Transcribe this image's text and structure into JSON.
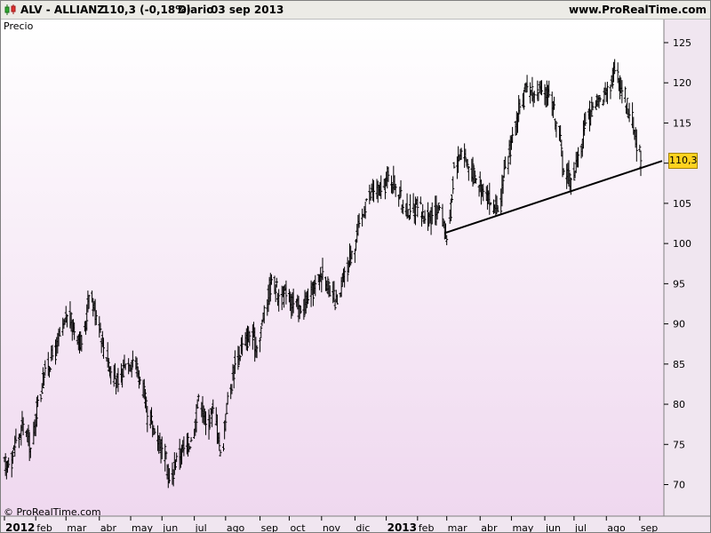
{
  "header": {
    "ticker": "ALV - ALLIANZ",
    "change": "110,3 (-0,18%)",
    "period": "Diario",
    "date": "03 sep 2013",
    "site": "www.ProRealTime.com"
  },
  "plot_label": "Precio",
  "copyright": "© ProRealTime.com",
  "last_price_label": "110,3",
  "colors": {
    "background": "#f0e6f0",
    "bars": "#000000",
    "price_box": "#ffd21f",
    "trendline": "#000000"
  },
  "chart_data": {
    "type": "ohlc",
    "title": "ALV - ALLIANZ",
    "xlabel": "",
    "ylabel": "",
    "ylim": [
      66,
      127
    ],
    "yticks": [
      70,
      75,
      80,
      85,
      90,
      95,
      100,
      105,
      110,
      115,
      120,
      125
    ],
    "x_range": [
      "2012-01-02",
      "2013-09-03"
    ],
    "xticks": [
      {
        "label": "2012",
        "date": "2012-01-02",
        "bold": true
      },
      {
        "label": "feb",
        "date": "2012-02-01",
        "bold": false
      },
      {
        "label": "mar",
        "date": "2012-03-01",
        "bold": false
      },
      {
        "label": "abr",
        "date": "2012-04-02",
        "bold": false
      },
      {
        "label": "may",
        "date": "2012-05-02",
        "bold": false
      },
      {
        "label": "jun",
        "date": "2012-06-01",
        "bold": false
      },
      {
        "label": "jul",
        "date": "2012-07-02",
        "bold": false
      },
      {
        "label": "ago",
        "date": "2012-08-01",
        "bold": false
      },
      {
        "label": "sep",
        "date": "2012-09-03",
        "bold": false
      },
      {
        "label": "oct",
        "date": "2012-10-01",
        "bold": false
      },
      {
        "label": "nov",
        "date": "2012-11-01",
        "bold": false
      },
      {
        "label": "dic",
        "date": "2012-12-03",
        "bold": false
      },
      {
        "label": "2013",
        "date": "2013-01-02",
        "bold": true
      },
      {
        "label": "feb",
        "date": "2013-02-01",
        "bold": false
      },
      {
        "label": "mar",
        "date": "2013-03-01",
        "bold": false
      },
      {
        "label": "abr",
        "date": "2013-04-02",
        "bold": false
      },
      {
        "label": "may",
        "date": "2013-05-02",
        "bold": false
      },
      {
        "label": "jun",
        "date": "2013-06-03",
        "bold": false
      },
      {
        "label": "jul",
        "date": "2013-07-01",
        "bold": false
      },
      {
        "label": "ago",
        "date": "2013-08-01",
        "bold": false
      },
      {
        "label": "sep",
        "date": "2013-09-02",
        "bold": false
      }
    ],
    "last_price": 110.3,
    "series": [
      {
        "weekly_close": [
          [
            "2012-01-02",
            72.5
          ],
          [
            "2012-01-09",
            75.5
          ],
          [
            "2012-01-16",
            77.5
          ],
          [
            "2012-01-23",
            74.5
          ],
          [
            "2012-01-30",
            80.5
          ],
          [
            "2012-02-06",
            84.5
          ],
          [
            "2012-02-13",
            86.0
          ],
          [
            "2012-02-20",
            88.5
          ],
          [
            "2012-02-27",
            91.0
          ],
          [
            "2012-03-05",
            89.0
          ],
          [
            "2012-03-12",
            87.5
          ],
          [
            "2012-03-19",
            93.5
          ],
          [
            "2012-03-26",
            91.0
          ],
          [
            "2012-04-02",
            87.0
          ],
          [
            "2012-04-09",
            84.0
          ],
          [
            "2012-04-16",
            82.5
          ],
          [
            "2012-04-23",
            85.0
          ],
          [
            "2012-04-30",
            85.5
          ],
          [
            "2012-05-07",
            83.0
          ],
          [
            "2012-05-14",
            78.5
          ],
          [
            "2012-05-21",
            76.5
          ],
          [
            "2012-05-28",
            74.5
          ],
          [
            "2012-06-04",
            70.5
          ],
          [
            "2012-06-11",
            73.5
          ],
          [
            "2012-06-18",
            74.5
          ],
          [
            "2012-06-25",
            75.5
          ],
          [
            "2012-07-02",
            81.0
          ],
          [
            "2012-07-09",
            77.5
          ],
          [
            "2012-07-16",
            79.5
          ],
          [
            "2012-07-23",
            74.0
          ],
          [
            "2012-07-30",
            81.0
          ],
          [
            "2012-08-06",
            85.0
          ],
          [
            "2012-08-13",
            87.5
          ],
          [
            "2012-08-20",
            88.5
          ],
          [
            "2012-08-27",
            87.0
          ],
          [
            "2012-09-03",
            92.0
          ],
          [
            "2012-09-10",
            95.5
          ],
          [
            "2012-09-17",
            93.5
          ],
          [
            "2012-09-24",
            93.5
          ],
          [
            "2012-10-01",
            92.5
          ],
          [
            "2012-10-08",
            91.5
          ],
          [
            "2012-10-15",
            93.0
          ],
          [
            "2012-10-22",
            95.0
          ],
          [
            "2012-10-29",
            96.5
          ],
          [
            "2012-11-05",
            93.5
          ],
          [
            "2012-11-12",
            92.5
          ],
          [
            "2012-11-19",
            96.5
          ],
          [
            "2012-11-26",
            99.0
          ],
          [
            "2012-12-03",
            102.5
          ],
          [
            "2012-12-10",
            105.5
          ],
          [
            "2012-12-17",
            106.5
          ],
          [
            "2012-12-24",
            106.5
          ],
          [
            "2012-12-31",
            108.5
          ],
          [
            "2013-01-07",
            107.0
          ],
          [
            "2013-01-14",
            104.5
          ],
          [
            "2013-01-21",
            104.0
          ],
          [
            "2013-01-28",
            104.5
          ],
          [
            "2013-02-04",
            103.0
          ],
          [
            "2013-02-11",
            103.5
          ],
          [
            "2013-02-18",
            104.5
          ],
          [
            "2013-02-25",
            100.5
          ],
          [
            "2013-03-04",
            109.5
          ],
          [
            "2013-03-11",
            111.5
          ],
          [
            "2013-03-18",
            109.5
          ],
          [
            "2013-03-25",
            108.0
          ],
          [
            "2013-04-01",
            106.5
          ],
          [
            "2013-04-08",
            105.0
          ],
          [
            "2013-04-15",
            104.0
          ],
          [
            "2013-04-22",
            109.5
          ],
          [
            "2013-04-29",
            113.5
          ],
          [
            "2013-05-06",
            117.0
          ],
          [
            "2013-05-13",
            119.5
          ],
          [
            "2013-05-20",
            118.5
          ],
          [
            "2013-05-27",
            119.0
          ],
          [
            "2013-06-03",
            118.5
          ],
          [
            "2013-06-10",
            115.0
          ],
          [
            "2013-06-17",
            109.0
          ],
          [
            "2013-06-24",
            108.0
          ],
          [
            "2013-07-01",
            111.0
          ],
          [
            "2013-07-08",
            115.0
          ],
          [
            "2013-07-15",
            117.0
          ],
          [
            "2013-07-22",
            118.0
          ],
          [
            "2013-07-29",
            119.5
          ],
          [
            "2013-08-05",
            121.5
          ],
          [
            "2013-08-12",
            119.0
          ],
          [
            "2013-08-19",
            116.0
          ],
          [
            "2013-08-26",
            112.0
          ],
          [
            "2013-09-03",
            110.3
          ]
        ]
      }
    ],
    "trendline": {
      "from": [
        "2013-02-27",
        101.3
      ],
      "to": [
        "2013-09-03",
        109.4
      ]
    }
  }
}
